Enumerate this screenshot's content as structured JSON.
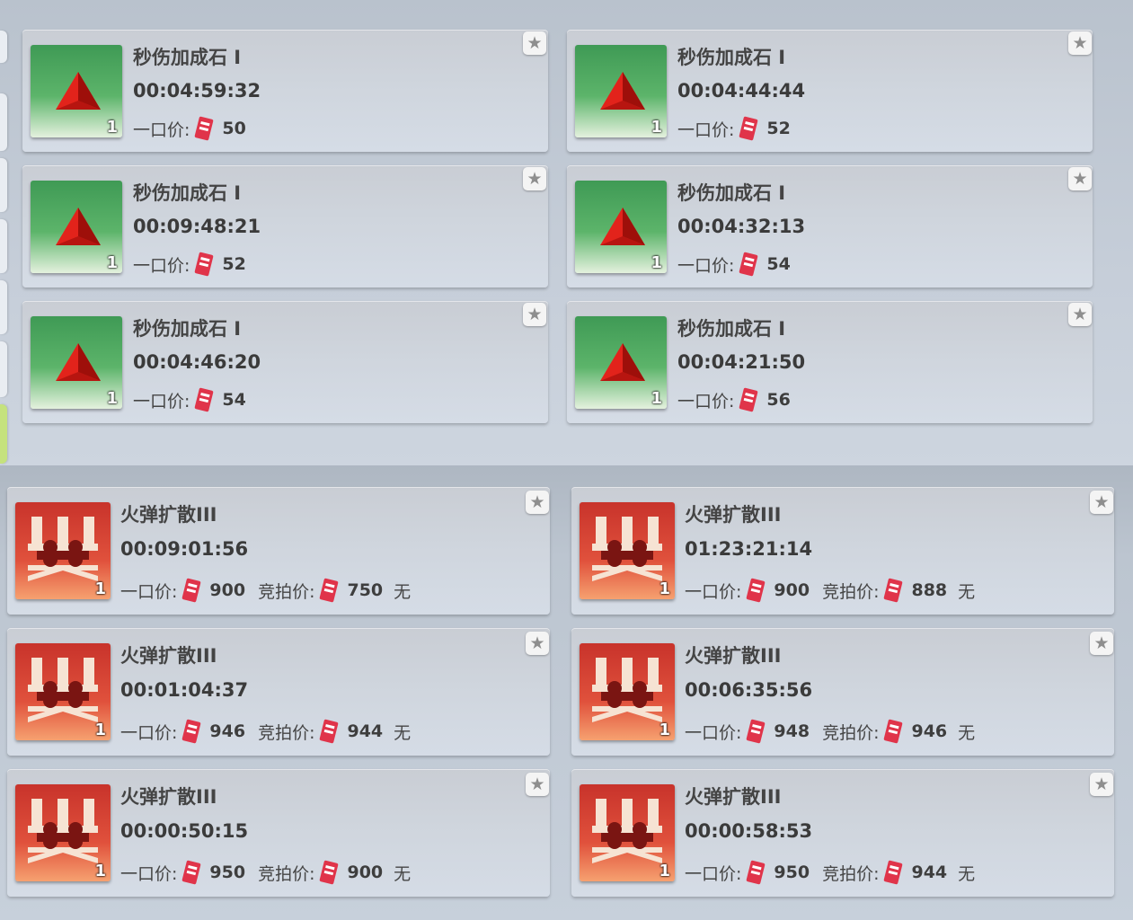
{
  "buyout_label": "一口价:",
  "bid_label": "竞拍价:",
  "no_bid_label": "无",
  "star_glyph": "★",
  "currency_icon": "red-ticket-icon",
  "stones": [
    {
      "name": "秒伤加成石 I",
      "timer": "00:04:59:32",
      "qty": "1",
      "buyout": "50"
    },
    {
      "name": "秒伤加成石 I",
      "timer": "00:04:44:44",
      "qty": "1",
      "buyout": "52"
    },
    {
      "name": "秒伤加成石 I",
      "timer": "00:09:48:21",
      "qty": "1",
      "buyout": "52"
    },
    {
      "name": "秒伤加成石 I",
      "timer": "00:04:32:13",
      "qty": "1",
      "buyout": "54"
    },
    {
      "name": "秒伤加成石 I",
      "timer": "00:04:46:20",
      "qty": "1",
      "buyout": "54"
    },
    {
      "name": "秒伤加成石 I",
      "timer": "00:04:21:50",
      "qty": "1",
      "buyout": "56"
    }
  ],
  "spreads": [
    {
      "name": "火弹扩散III",
      "timer": "00:09:01:56",
      "qty": "1",
      "buyout": "900",
      "bid": "750"
    },
    {
      "name": "火弹扩散III",
      "timer": "01:23:21:14",
      "qty": "1",
      "buyout": "900",
      "bid": "888"
    },
    {
      "name": "火弹扩散III",
      "timer": "00:01:04:37",
      "qty": "1",
      "buyout": "946",
      "bid": "944"
    },
    {
      "name": "火弹扩散III",
      "timer": "00:06:35:56",
      "qty": "1",
      "buyout": "948",
      "bid": "946"
    },
    {
      "name": "火弹扩散III",
      "timer": "00:00:50:15",
      "qty": "1",
      "buyout": "950",
      "bid": "900"
    },
    {
      "name": "火弹扩散III",
      "timer": "00:00:58:53",
      "qty": "1",
      "buyout": "950",
      "bid": "944"
    }
  ],
  "colors": {
    "stone_icon": "#4aa85c",
    "spread_icon": "#d8442f",
    "currency": "#e0344a",
    "active_tab": "#c5e27d"
  }
}
